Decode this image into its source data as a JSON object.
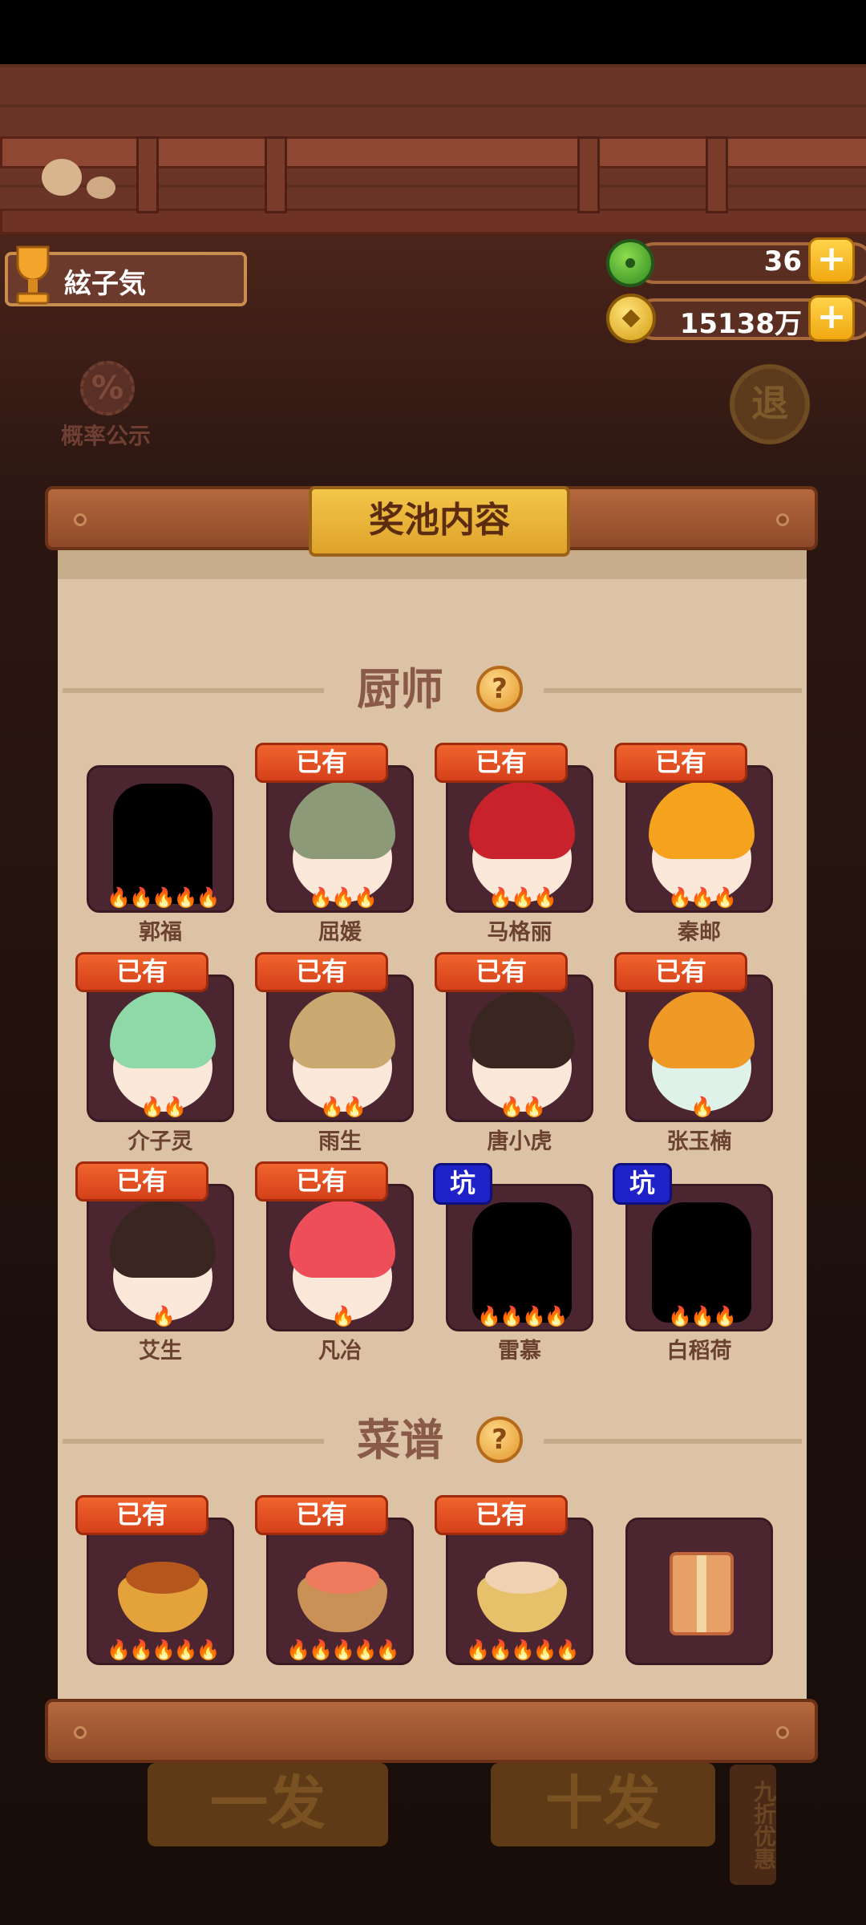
{
  "player": {
    "name": "絃子気"
  },
  "resources": {
    "jade": "36",
    "gold": "15138万"
  },
  "left_button": {
    "label": "概率公示",
    "icon": "%"
  },
  "right_button": {
    "label": "退"
  },
  "panel": {
    "title": "奖池内容"
  },
  "sections": {
    "chefs": {
      "title": "厨师",
      "help": "?"
    },
    "recipes": {
      "title": "菜谱",
      "help": "?"
    }
  },
  "chefs": [
    {
      "name": "郭福",
      "tag": "",
      "stars": "🔥🔥🔥🔥🔥",
      "look": "silhouette"
    },
    {
      "name": "屈媛",
      "tag": "已有",
      "stars": "🔥🔥🔥",
      "look": "green"
    },
    {
      "name": "马格丽",
      "tag": "已有",
      "stars": "🔥🔥🔥",
      "look": "red"
    },
    {
      "name": "秦邮",
      "tag": "已有",
      "stars": "🔥🔥🔥",
      "look": "orange"
    },
    {
      "name": "介子灵",
      "tag": "已有",
      "stars": "🔥🔥",
      "look": "mint"
    },
    {
      "name": "雨生",
      "tag": "已有",
      "stars": "🔥🔥",
      "look": "brown"
    },
    {
      "name": "唐小虎",
      "tag": "已有",
      "stars": "🔥🔥",
      "look": "dark"
    },
    {
      "name": "张玉楠",
      "tag": "已有",
      "stars": "🔥",
      "look": "pumpkin"
    },
    {
      "name": "艾生",
      "tag": "已有",
      "stars": "🔥",
      "look": "dark"
    },
    {
      "name": "凡冶",
      "tag": "已有",
      "stars": "🔥",
      "look": "pink"
    },
    {
      "name": "雷慕",
      "tag": "坑",
      "stars": "🔥🔥🔥🔥",
      "look": "silhouette"
    },
    {
      "name": "白稻荷",
      "tag": "坑",
      "stars": "🔥🔥🔥",
      "look": "silhouette"
    }
  ],
  "recipes": [
    {
      "tag": "已有",
      "stars": "🔥🔥🔥🔥🔥",
      "look": "curry"
    },
    {
      "tag": "已有",
      "stars": "🔥🔥🔥🔥🔥",
      "look": "sashimi"
    },
    {
      "tag": "已有",
      "stars": "🔥🔥🔥🔥🔥",
      "look": "shrimp"
    },
    {
      "tag": "",
      "stars": "",
      "look": "gift"
    }
  ],
  "bottom_buttons": {
    "single": "一发",
    "ten": "十发",
    "discount": "九折优惠"
  },
  "colors": {
    "owned_tag": "#e0501f",
    "pit_tag": "#1f22c8",
    "panel": "#dcc3a5"
  }
}
